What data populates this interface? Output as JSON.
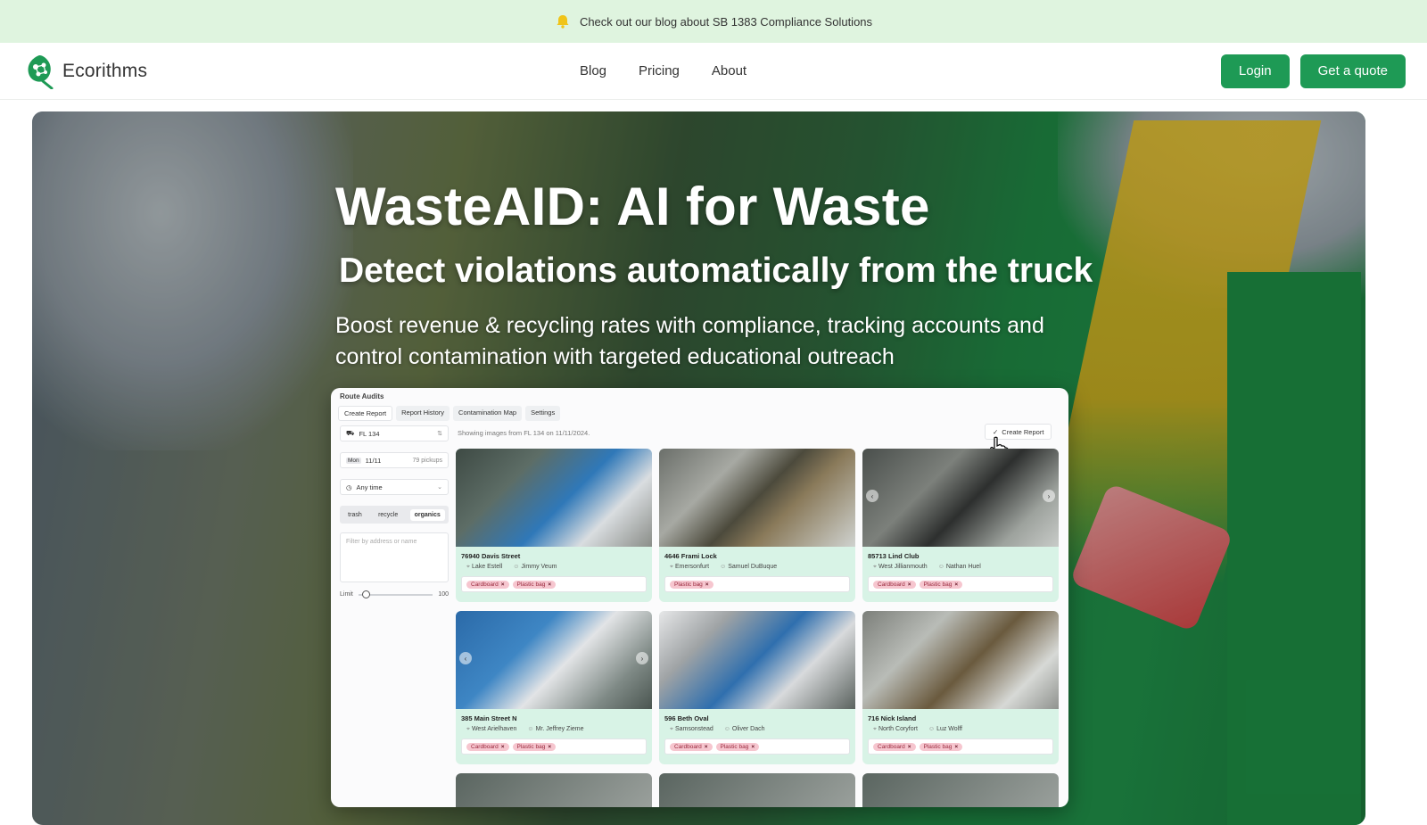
{
  "announcement": {
    "text": "Check out our blog about SB 1383  Compliance Solutions",
    "icon": "bell-icon"
  },
  "brand": {
    "name": "Ecorithms",
    "logo": "leaf-logo"
  },
  "nav": {
    "links": [
      "Blog",
      "Pricing",
      "About"
    ]
  },
  "actions": {
    "login": "Login",
    "quote": "Get a quote"
  },
  "hero": {
    "title": "WasteAID: AI for Waste",
    "subtitle": "Detect violations automatically from the truck",
    "description": "Boost revenue & recycling rates with compliance, tracking accounts and control contamination with targeted educational outreach"
  },
  "app": {
    "title": "Route Audits",
    "tabs": [
      "Create Report",
      "Report History",
      "Contamination Map",
      "Settings"
    ],
    "route_select": "FL 134",
    "date_select": "11/11",
    "day_label": "Mon",
    "pickups": "79 pickups",
    "time_select": "Any time",
    "stream_options": [
      "trash",
      "recycle",
      "organics"
    ],
    "stream_selected": "organics",
    "filter_placeholder": "Filter by address or name",
    "limit_label": "Limit",
    "limit_value": "100",
    "showing": "Showing images from FL 134 on 11/11/2024.",
    "create_report": "Create Report",
    "cards": [
      {
        "address": "76940 Davis Street",
        "city": "Lake Estell",
        "name": "Jimmy Veum",
        "tags": [
          "Cardboard",
          "Plastic bag"
        ]
      },
      {
        "address": "4646 Frami Lock",
        "city": "Emersonfurt",
        "name": "Samuel DuBuque",
        "tags": [
          "Plastic bag"
        ]
      },
      {
        "address": "85713 Lind Club",
        "city": "West Jillianmouth",
        "name": "Nathan Huel",
        "tags": [
          "Cardboard",
          "Plastic bag"
        ]
      },
      {
        "address": "385 Main Street N",
        "city": "West Arielhaven",
        "name": "Mr. Jeffrey Zieme",
        "tags": [
          "Cardboard",
          "Plastic bag"
        ]
      },
      {
        "address": "596 Beth Oval",
        "city": "Samsonstead",
        "name": "Oliver Dach",
        "tags": [
          "Cardboard",
          "Plastic bag"
        ]
      },
      {
        "address": "716 Nick Island",
        "city": "North Coryfort",
        "name": "Luz Wolff",
        "tags": [
          "Cardboard",
          "Plastic bag"
        ]
      }
    ]
  },
  "colors": {
    "accent": "#1e9a55",
    "banner": "#dff4df",
    "card": "#d8f3e6",
    "tag": "#f6c6cf"
  }
}
